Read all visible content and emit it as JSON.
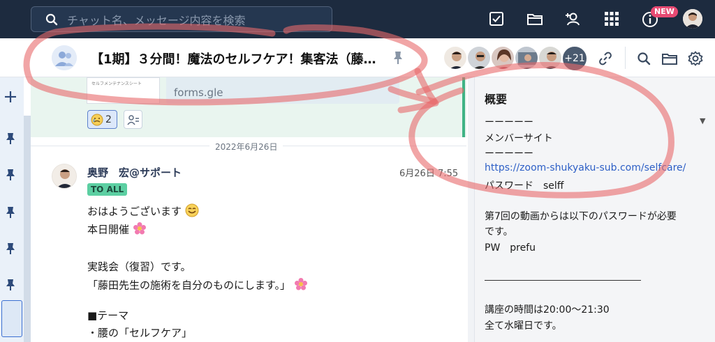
{
  "search": {
    "placeholder": "チャット名、メッセージ内容を検索"
  },
  "topbar": {
    "new_badge": "NEW"
  },
  "header": {
    "room_title": "【1期】３分間！魔法のセルフケア！集客法（藤…",
    "member_extra": "+21"
  },
  "chat": {
    "preview_card_title": "セルフメンテナンスシート",
    "preview_link": "forms.gle",
    "reaction_count": "2",
    "date_divider": "2022年6月26日",
    "message": {
      "sender": "奥野　宏@サポート",
      "time": "6月26日 7:55",
      "badge": "TO ALL",
      "lines": [
        "おはようございます",
        "本日開催",
        "実践会（復習）です。",
        "「藤田先生の施術を自分のものにします。」",
        "■テーマ",
        "・腰の「セルフケア」"
      ]
    }
  },
  "sidebar": {
    "heading": "概要",
    "lines": [
      "ーーーーー",
      "メンバーサイト",
      "ーーーーー",
      "https://zoom-shukyaku-sub.com/selfcare/",
      "パスワード　selff",
      "第7回の動画からは以下のパスワードが必要",
      "です。",
      "PW　prefu",
      "講座の時間は20:00〜21:30",
      "全て水曜日です。"
    ]
  },
  "colors": {
    "topbar_bg": "#1d2b3f",
    "accent": "#2d5fc6",
    "annotation": "#e8696a",
    "new_badge": "#e84a73"
  }
}
